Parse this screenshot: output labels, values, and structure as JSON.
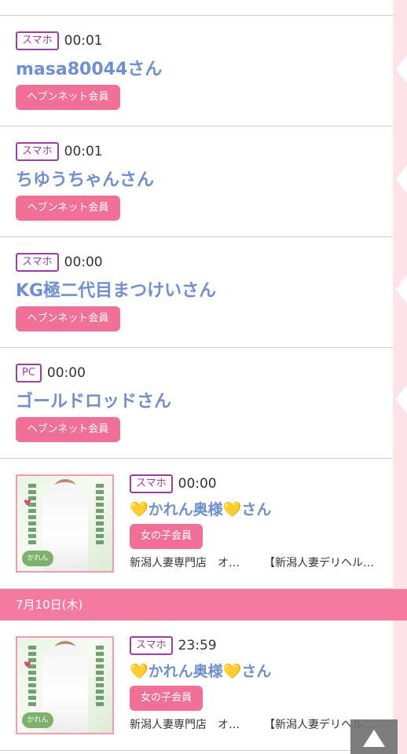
{
  "entries": [
    {
      "device": "スマホ",
      "time": "00:01",
      "name": "masa80044さん",
      "badge": "ヘブンネット会員"
    },
    {
      "device": "スマホ",
      "time": "00:01",
      "name": "ちゆうちゃんさん",
      "badge": "ヘブンネット会員"
    },
    {
      "device": "スマホ",
      "time": "00:00",
      "name": "KG極二代目まつけいさん",
      "badge": "ヘブンネット会員"
    },
    {
      "device": "PC",
      "time": "00:00",
      "name": "ゴールドロッドさん",
      "badge": "ヘブンネット会員"
    }
  ],
  "girl_entries": [
    {
      "device": "スマホ",
      "time": "00:00",
      "heart": "💛",
      "name": "かれん奥様",
      "heart2": "💛",
      "suffix": "さん",
      "badge": "女の子会員",
      "shop": "新潟人妻専門店　オ…",
      "ad": "【新潟人妻デリヘル…",
      "thumb_brand": "かれん"
    },
    {
      "device": "スマホ",
      "time": "23:59",
      "heart": "💛",
      "name": "かれん奥様",
      "heart2": "💛",
      "suffix": "さん",
      "badge": "女の子会員",
      "shop": "新潟人妻専門店　オ…",
      "ad": "【新潟人妻デリヘル…",
      "thumb_brand": "かれん"
    }
  ],
  "date_separator": "7月10日(木)",
  "scroll_top_icon": "triangle-up-icon",
  "colors": {
    "accent_pink": "#f07098",
    "name_blue": "#6f8fd0",
    "device_purple": "#9b3fa4",
    "date_bar": "#f47aa0"
  }
}
